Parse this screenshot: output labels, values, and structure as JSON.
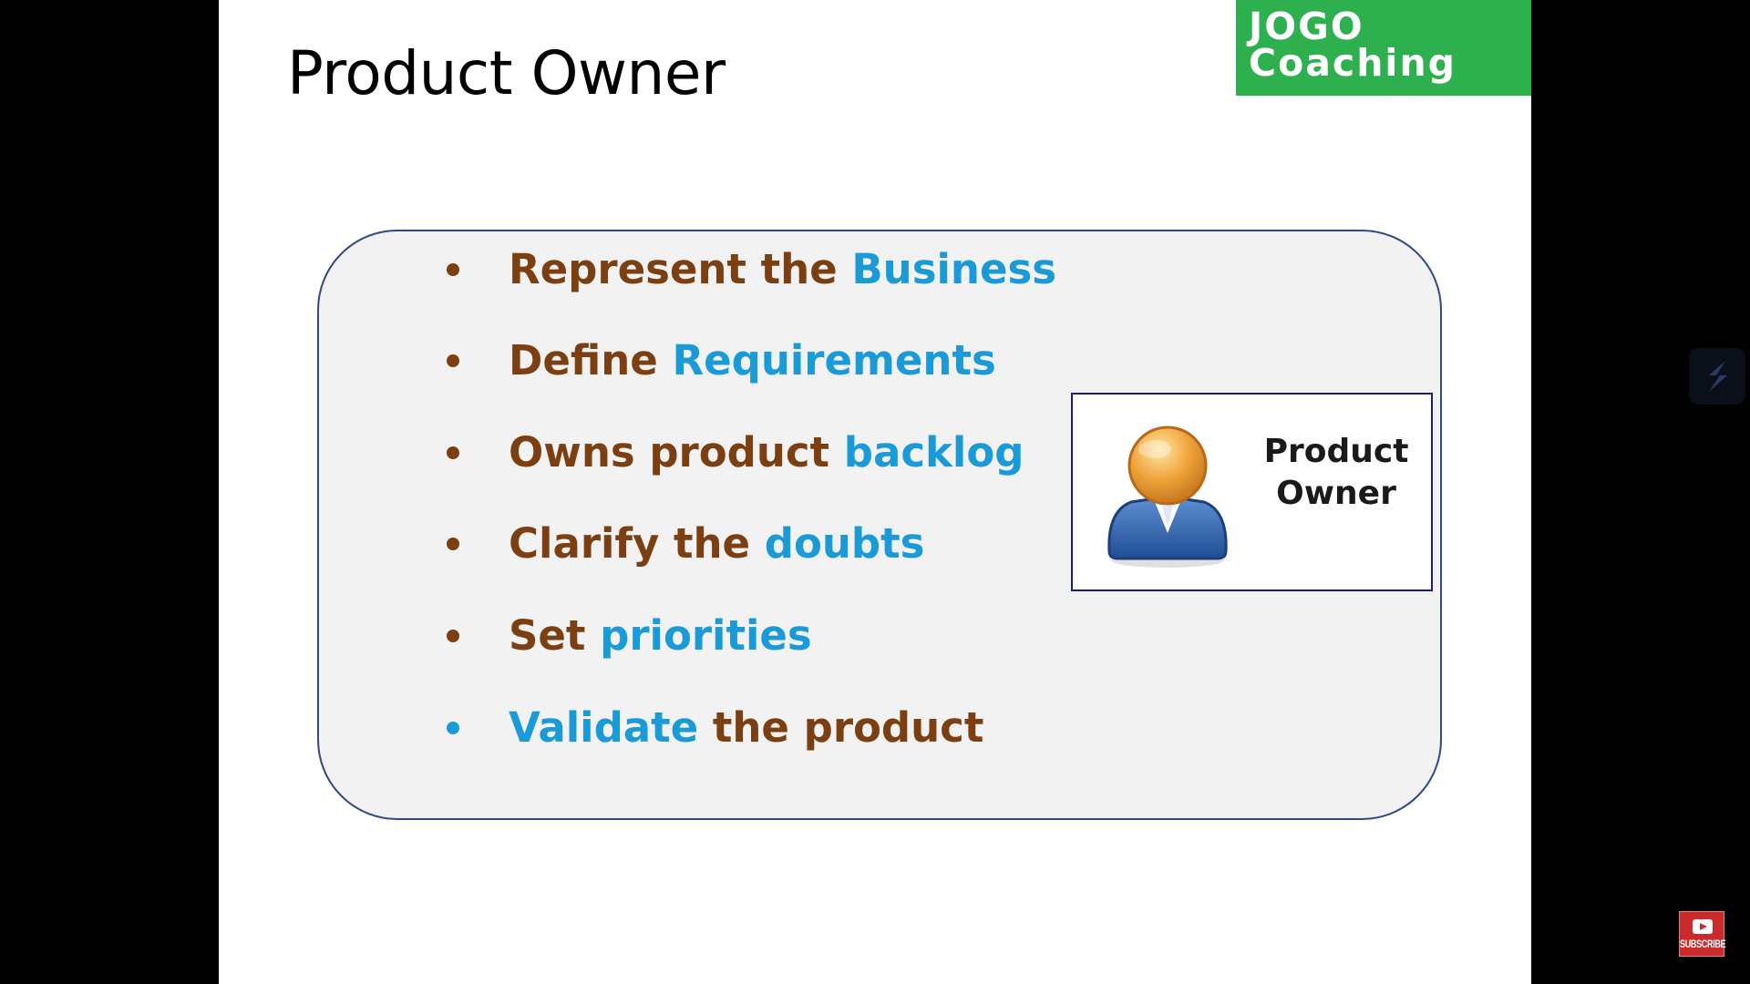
{
  "slide": {
    "title": "Product Owner",
    "logo": {
      "line1": "JOGO",
      "line2": "Coaching",
      "color": "#2eb04f"
    },
    "bullets": [
      {
        "segments": [
          {
            "text": "Represent the ",
            "color": "brown"
          },
          {
            "text": "Business",
            "color": "blue"
          }
        ],
        "dot": "brown"
      },
      {
        "segments": [
          {
            "text": "Define ",
            "color": "brown"
          },
          {
            "text": "Requirements",
            "color": "blue"
          }
        ],
        "dot": "brown"
      },
      {
        "segments": [
          {
            "text": "Owns product ",
            "color": "brown"
          },
          {
            "text": "backlog",
            "color": "blue"
          }
        ],
        "dot": "brown"
      },
      {
        "segments": [
          {
            "text": "Clarify the ",
            "color": "brown"
          },
          {
            "text": "doubts",
            "color": "blue"
          }
        ],
        "dot": "brown"
      },
      {
        "segments": [
          {
            "text": "Set ",
            "color": "brown"
          },
          {
            "text": "priorities",
            "color": "blue"
          }
        ],
        "dot": "brown"
      },
      {
        "segments": [
          {
            "text": "Validate",
            "color": "blue"
          },
          {
            "text": " the product",
            "color": "brown"
          }
        ],
        "dot": "blue"
      }
    ],
    "role_card": {
      "line1": "Product",
      "line2": "Owner",
      "icon": "user-avatar-icon"
    }
  },
  "overlay": {
    "subscribe_label": "SUBSCRIBE",
    "subscribe_icon": "youtube-play-icon",
    "side_icon": "app-logo-icon"
  },
  "colors": {
    "brown": "#7b3f12",
    "blue": "#1a9ad6",
    "panel_border": "#2f4a84",
    "panel_fill": "#f2f2f2"
  }
}
